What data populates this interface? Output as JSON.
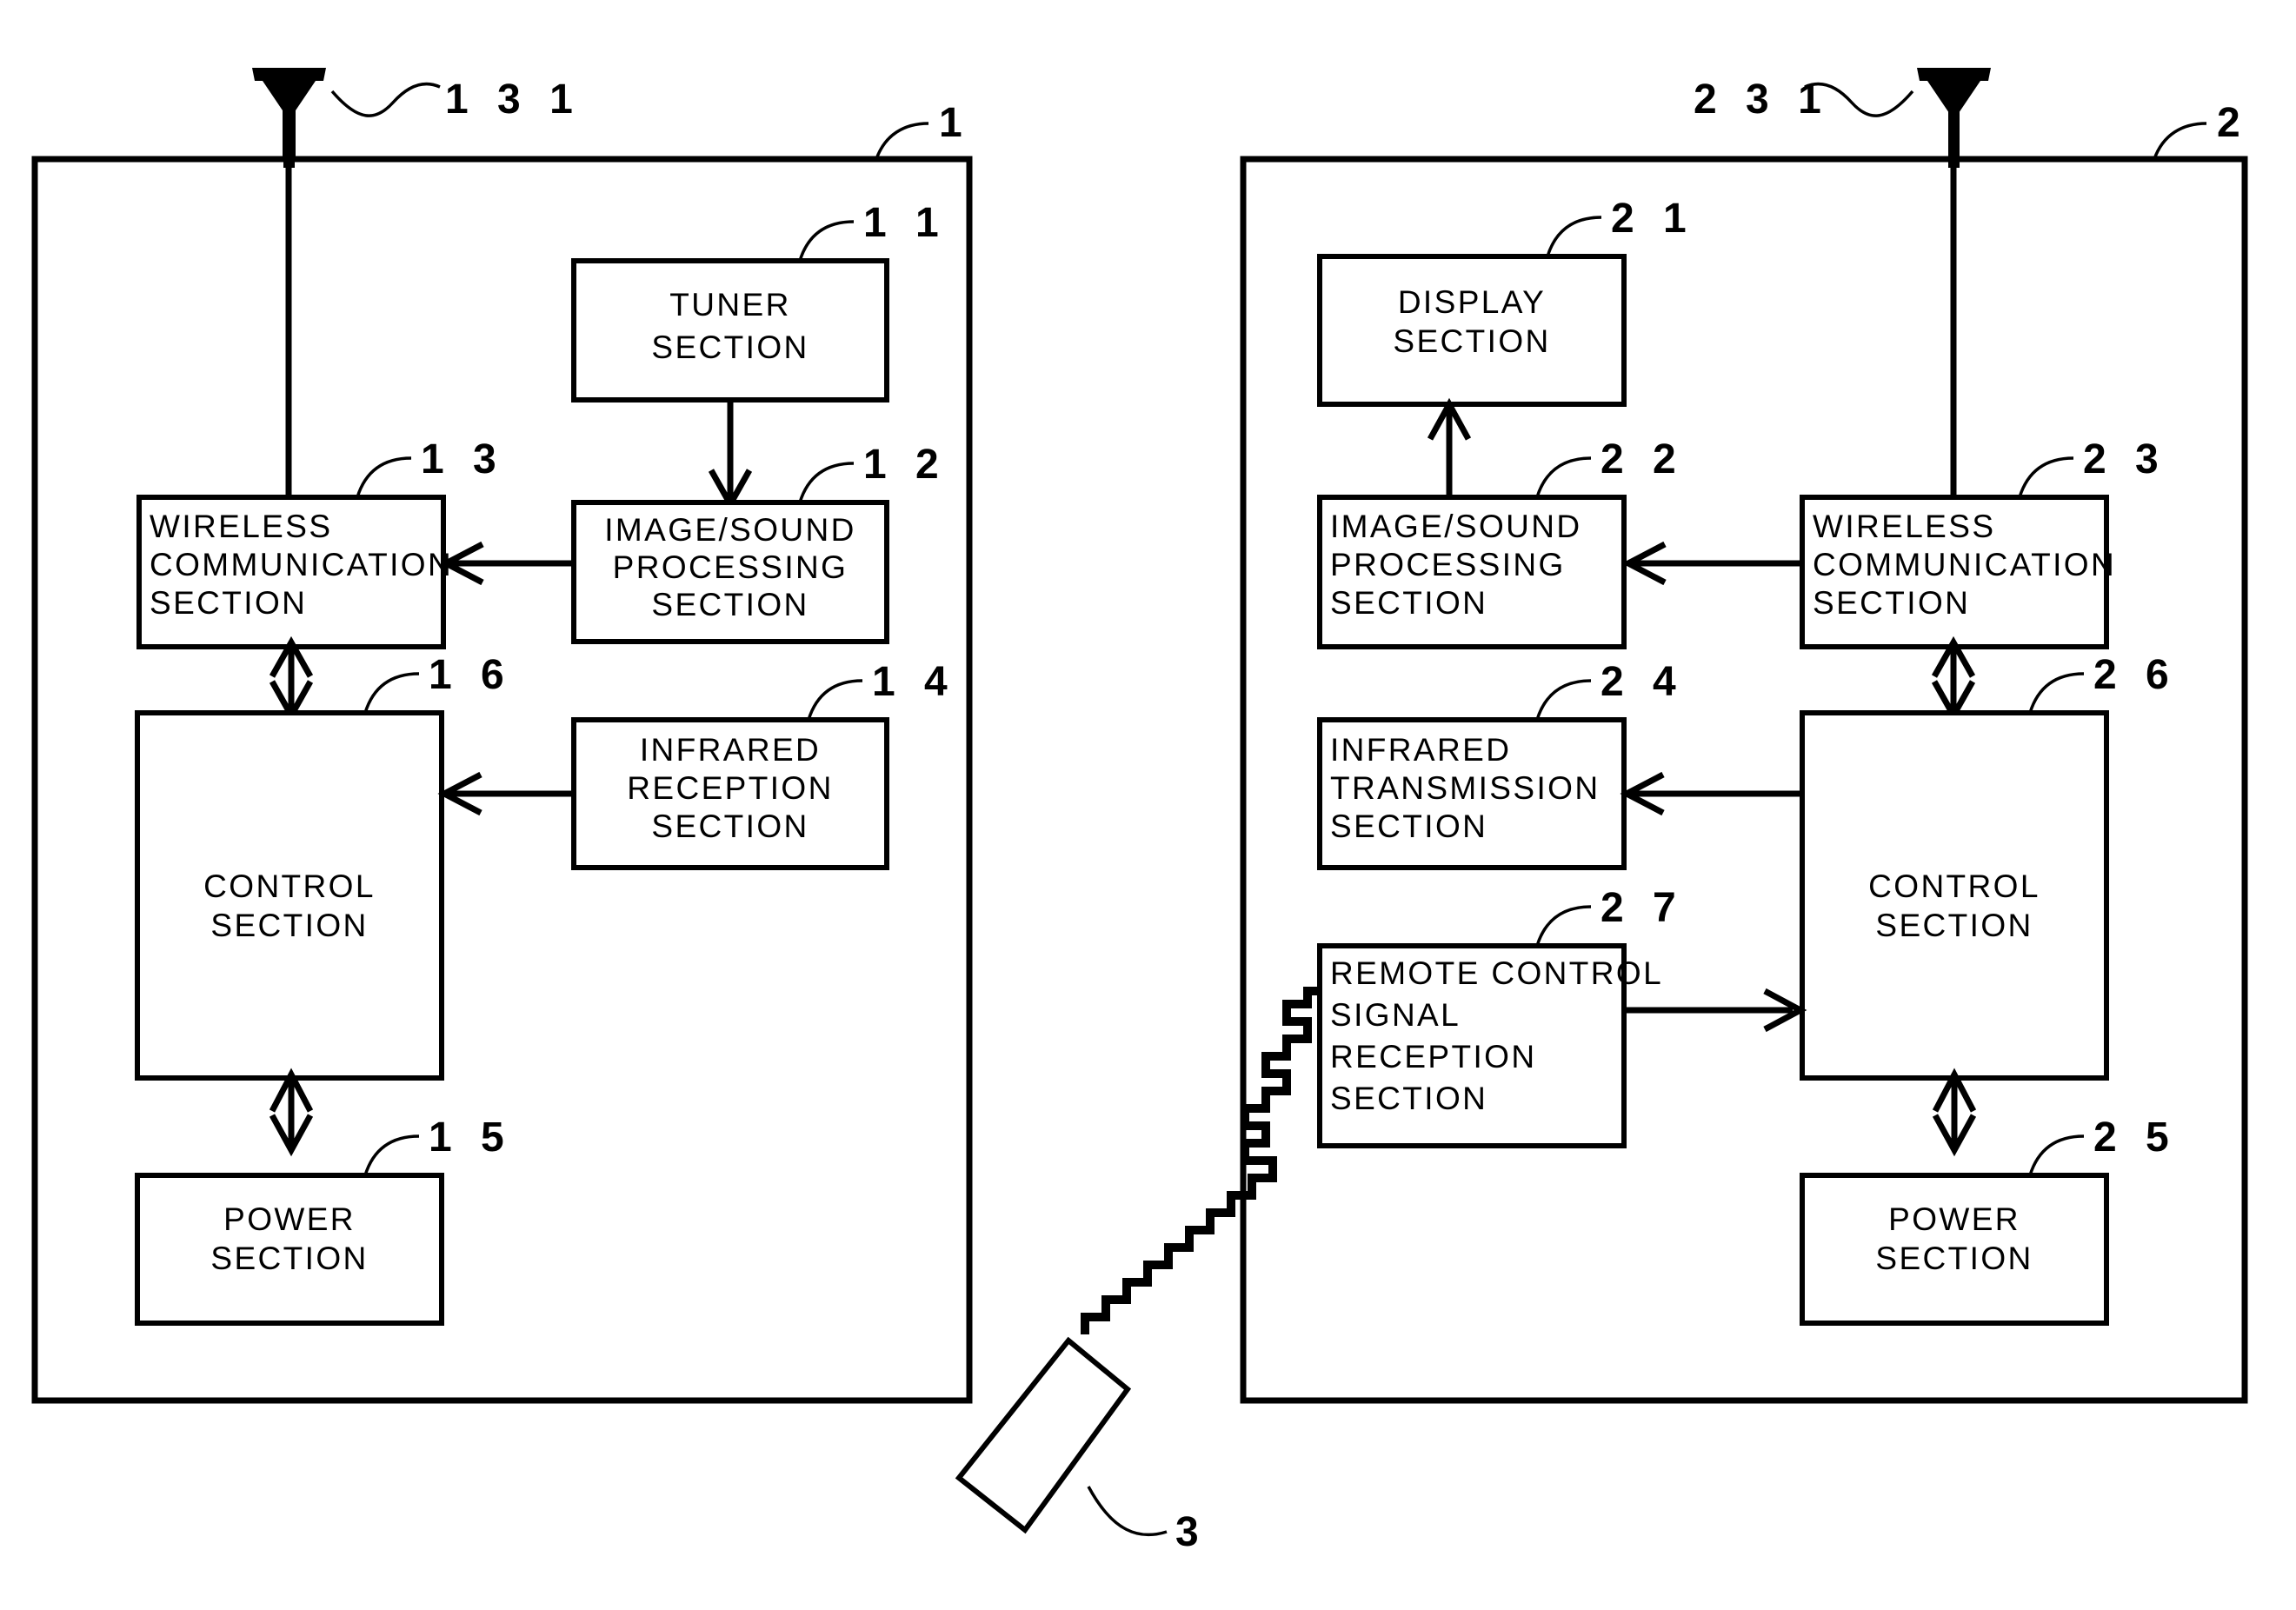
{
  "figure": {
    "title": "Wireless image transmission system block diagram",
    "type": "patent-block-diagram"
  },
  "devices": {
    "transmitter": {
      "ref": "1",
      "antenna_ref": "131",
      "blocks": [
        {
          "ref": "11",
          "lines": [
            "TUNER",
            "SECTION"
          ],
          "align": "center"
        },
        {
          "ref": "12",
          "lines": [
            "IMAGE/SOUND",
            "PROCESSING",
            "SECTION"
          ],
          "align": "center"
        },
        {
          "ref": "13",
          "lines": [
            "WIRELESS",
            "COMMUNICATION",
            "SECTION"
          ],
          "align": "left"
        },
        {
          "ref": "14",
          "lines": [
            "INFRARED",
            "RECEPTION",
            "SECTION"
          ],
          "align": "center"
        },
        {
          "ref": "15",
          "lines": [
            "POWER",
            "SECTION"
          ],
          "align": "center"
        },
        {
          "ref": "16",
          "lines": [
            "CONTROL",
            "SECTION"
          ],
          "align": "center"
        }
      ]
    },
    "receiver": {
      "ref": "2",
      "antenna_ref": "231",
      "blocks": [
        {
          "ref": "21",
          "lines": [
            "DISPLAY",
            "SECTION"
          ],
          "align": "center"
        },
        {
          "ref": "22",
          "lines": [
            "IMAGE/SOUND",
            "PROCESSING",
            "SECTION"
          ],
          "align": "left"
        },
        {
          "ref": "23",
          "lines": [
            "WIRELESS",
            "COMMUNICATION",
            "SECTION"
          ],
          "align": "left"
        },
        {
          "ref": "24",
          "lines": [
            "INFRARED",
            "TRANSMISSION",
            "SECTION"
          ],
          "align": "left"
        },
        {
          "ref": "25",
          "lines": [
            "POWER",
            "SECTION"
          ],
          "align": "center"
        },
        {
          "ref": "26",
          "lines": [
            "CONTROL",
            "SECTION"
          ],
          "align": "center"
        },
        {
          "ref": "27",
          "lines": [
            "REMOTE CONTROL",
            "SIGNAL",
            "RECEPTION",
            "SECTION"
          ],
          "align": "left"
        }
      ]
    },
    "remote_controller": {
      "ref": "3",
      "shape": "tilted-rectangle"
    }
  },
  "labels": {
    "dev1": "1",
    "dev2": "2",
    "dev3": "3",
    "ant131": "1 3 1",
    "ant231": "2 3 1",
    "b11": "1 1",
    "b12": "1 2",
    "b13": "1 3",
    "b14": "1 4",
    "b15": "1 5",
    "b16": "1 6",
    "b21": "2 1",
    "b22": "2 2",
    "b23": "2 3",
    "b24": "2 4",
    "b25": "2 5",
    "b26": "2 6",
    "b27": "2 7"
  },
  "text": {
    "tuner_l1": "TUNER",
    "tuner_l2": "SECTION",
    "imgsnd_l1": "IMAGE/SOUND",
    "imgsnd_l2": "PROCESSING",
    "imgsnd_l3": "SECTION",
    "wireless_l1": "WIRELESS",
    "wireless_l2": "COMMUNICATION",
    "wireless_l3": "SECTION",
    "irrecv_l1": "INFRARED",
    "irrecv_l2": "RECEPTION",
    "irrecv_l3": "SECTION",
    "irxmit_l1": "INFRARED",
    "irxmit_l2": "TRANSMISSION",
    "irxmit_l3": "SECTION",
    "control_l1": "CONTROL",
    "control_l2": "SECTION",
    "power_l1": "POWER",
    "power_l2": "SECTION",
    "display_l1": "DISPLAY",
    "display_l2": "SECTION",
    "rcsr_l1": "REMOTE CONTROL",
    "rcsr_l2": "SIGNAL",
    "rcsr_l3": "RECEPTION",
    "rcsr_l4": "SECTION"
  },
  "colors": {
    "ink": "#000000",
    "paper": "#ffffff"
  }
}
